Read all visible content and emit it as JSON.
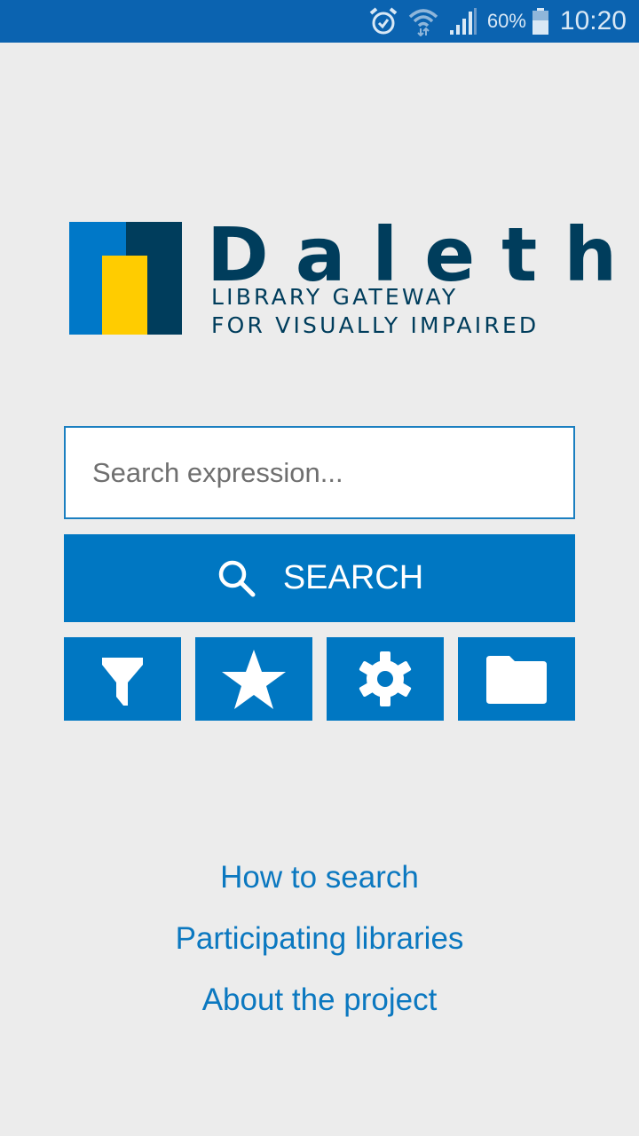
{
  "status_bar": {
    "icons": [
      "alarm-icon",
      "wifi-icon",
      "signal-icon",
      "battery-icon"
    ],
    "battery_percent": "60%",
    "time": "10:20"
  },
  "logo": {
    "title": "Daleth",
    "subtitle_line1": "LIBRARY GATEWAY",
    "subtitle_line2": "FOR VISUALLY IMPAIRED",
    "colors": {
      "blue": "#0078c8",
      "navy": "#003d5c",
      "yellow": "#ffcc00"
    }
  },
  "search": {
    "placeholder": "Search expression...",
    "value": "",
    "button_label": "SEARCH",
    "button_icon": "search-icon"
  },
  "quick_actions": [
    {
      "icon": "filter-icon",
      "name": "filter"
    },
    {
      "icon": "star-icon",
      "name": "favorites"
    },
    {
      "icon": "gear-icon",
      "name": "settings"
    },
    {
      "icon": "folder-icon",
      "name": "folder"
    }
  ],
  "links": [
    {
      "label": "How to search"
    },
    {
      "label": "Participating libraries"
    },
    {
      "label": "About the project"
    }
  ],
  "theme": {
    "primary": "#0077c2",
    "statusbar": "#0b63b0",
    "background": "#ececec",
    "link": "#0b78c0"
  }
}
